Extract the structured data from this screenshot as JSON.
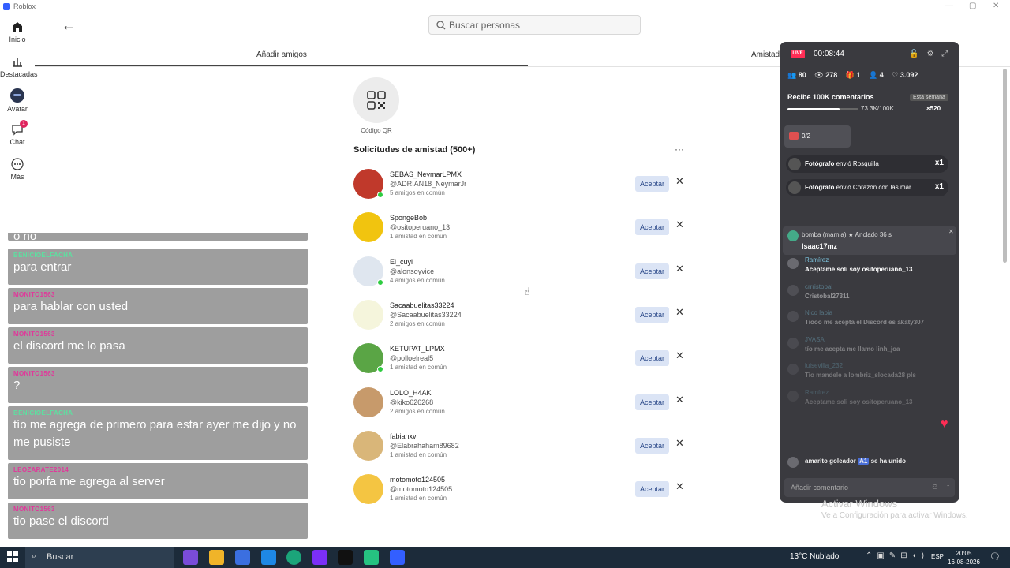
{
  "window": {
    "title": "Roblox"
  },
  "sidebar": {
    "items": [
      {
        "label": "Inicio",
        "icon": "home-icon"
      },
      {
        "label": "Destacadas",
        "icon": "chart-icon"
      },
      {
        "label": "Avatar",
        "icon": "avatar-icon"
      },
      {
        "label": "Chat",
        "icon": "chat-icon",
        "badge": "1"
      },
      {
        "label": "Más",
        "icon": "more-icon"
      }
    ]
  },
  "search": {
    "placeholder": "Buscar personas"
  },
  "tabs": [
    {
      "label": "Añadir amigos"
    },
    {
      "label": "Amistades"
    }
  ],
  "qr": {
    "label": "Código QR"
  },
  "requests": {
    "title": "Solicitudes de amistad (500+)",
    "accept_label": "Aceptar",
    "items": [
      {
        "name": "SEBAS_NeymarLPMX",
        "handle": "@ADRIAN18_NeymarJr",
        "mutual": "5 amigos en común",
        "online": true
      },
      {
        "name": "SpongeBob",
        "handle": "@ositoperuano_13",
        "mutual": "1 amistad en común",
        "online": false
      },
      {
        "name": "El_cuyi",
        "handle": "@alonsoyvice",
        "mutual": "4 amigos en común",
        "online": true
      },
      {
        "name": "Sacaabuelitas33224",
        "handle": "@Sacaabuelitas33224",
        "mutual": "2 amigos en común",
        "online": false
      },
      {
        "name": "KETUPAT_LPMX",
        "handle": "@polloelreal5",
        "mutual": "1 amistad en común",
        "online": true
      },
      {
        "name": "LOLO_H4AK",
        "handle": "@kiko626268",
        "mutual": "2 amigos en común",
        "online": false
      },
      {
        "name": "fabianxv",
        "handle": "@Elabrahaham89682",
        "mutual": "1 amistad en común",
        "online": false
      },
      {
        "name": "motomoto124505",
        "handle": "@motomoto124505",
        "mutual": "1 amistad en común",
        "online": false
      }
    ]
  },
  "chat_overlay": {
    "messages": [
      {
        "user": "",
        "text": "o no"
      },
      {
        "user": "BENICIOELFACHA",
        "text": "para entrar",
        "color": "#5de0a0"
      },
      {
        "user": "MONITO1563",
        "text": "para hablar con usted",
        "color": "#e0389a"
      },
      {
        "user": "MONITO1563",
        "text": "el discord me lo pasa",
        "color": "#e0389a"
      },
      {
        "user": "MONITO1563",
        "text": "?",
        "color": "#e0389a"
      },
      {
        "user": "BENICIOELFACHA",
        "text": "tío me agrega de primero para estar ayer me dijo y no me pusiste",
        "color": "#5de0a0"
      },
      {
        "user": "LEOZARATE2014",
        "text": "tio porfa me agrega al server",
        "color": "#e0389a"
      },
      {
        "user": "MONITO1563",
        "text": "tio pase el discord",
        "color": "#e0389a"
      }
    ]
  },
  "live": {
    "badge": "LIVE",
    "time": "00:08:44",
    "stats": {
      "members": "80",
      "viewers": "278",
      "gifts": "1",
      "followers": "4",
      "likes": "3.092"
    },
    "goal": {
      "title": "Recibe 100K comentarios",
      "period": "Esta semana",
      "progress_text": "73.3K/100K",
      "progress": 0.733,
      "gift_count": "×520"
    },
    "treasure": "0/2",
    "gifts": [
      {
        "user": "Fotógrafo",
        "text": "envió Rosquilla",
        "mult": "x1"
      },
      {
        "user": "Fotógrafo",
        "text": "envió Corazón con las mar",
        "mult": "x1"
      }
    ],
    "pinned": {
      "user": "bomba",
      "extra": "(marnia)",
      "tag": "Anclado",
      "ago": "36 s",
      "text": "Isaac17mz"
    },
    "comments": [
      {
        "user": "Ramírez",
        "text": "Aceptame soli soy ositoperuano_13"
      },
      {
        "user": "crrristobal",
        "text": "Cristobal27311"
      },
      {
        "user": "Nico lapia",
        "text": "Tiooo me acepta el Discord es akaty307"
      },
      {
        "user": "JVASA",
        "text": "tío me acepta me llamo linh_joa"
      },
      {
        "user": "luisevilla_232",
        "text": "Tio mandele a lombriz_slocada28 pls"
      },
      {
        "user": "Ramírez",
        "text": "Aceptame soli soy ositoperuano_13"
      }
    ],
    "joined": {
      "user": "amarito goleador",
      "tag": "A1",
      "text": "se ha unido"
    },
    "input_placeholder": "Añadir comentario"
  },
  "watermark": {
    "line1": "Activar Windows",
    "line2": "Ve a Configuración para activar Windows."
  },
  "taskbar": {
    "search": "Buscar",
    "weather": "13°C  Nublado",
    "lang": "ESP",
    "time": "20:05",
    "date": "16-08-2026"
  }
}
